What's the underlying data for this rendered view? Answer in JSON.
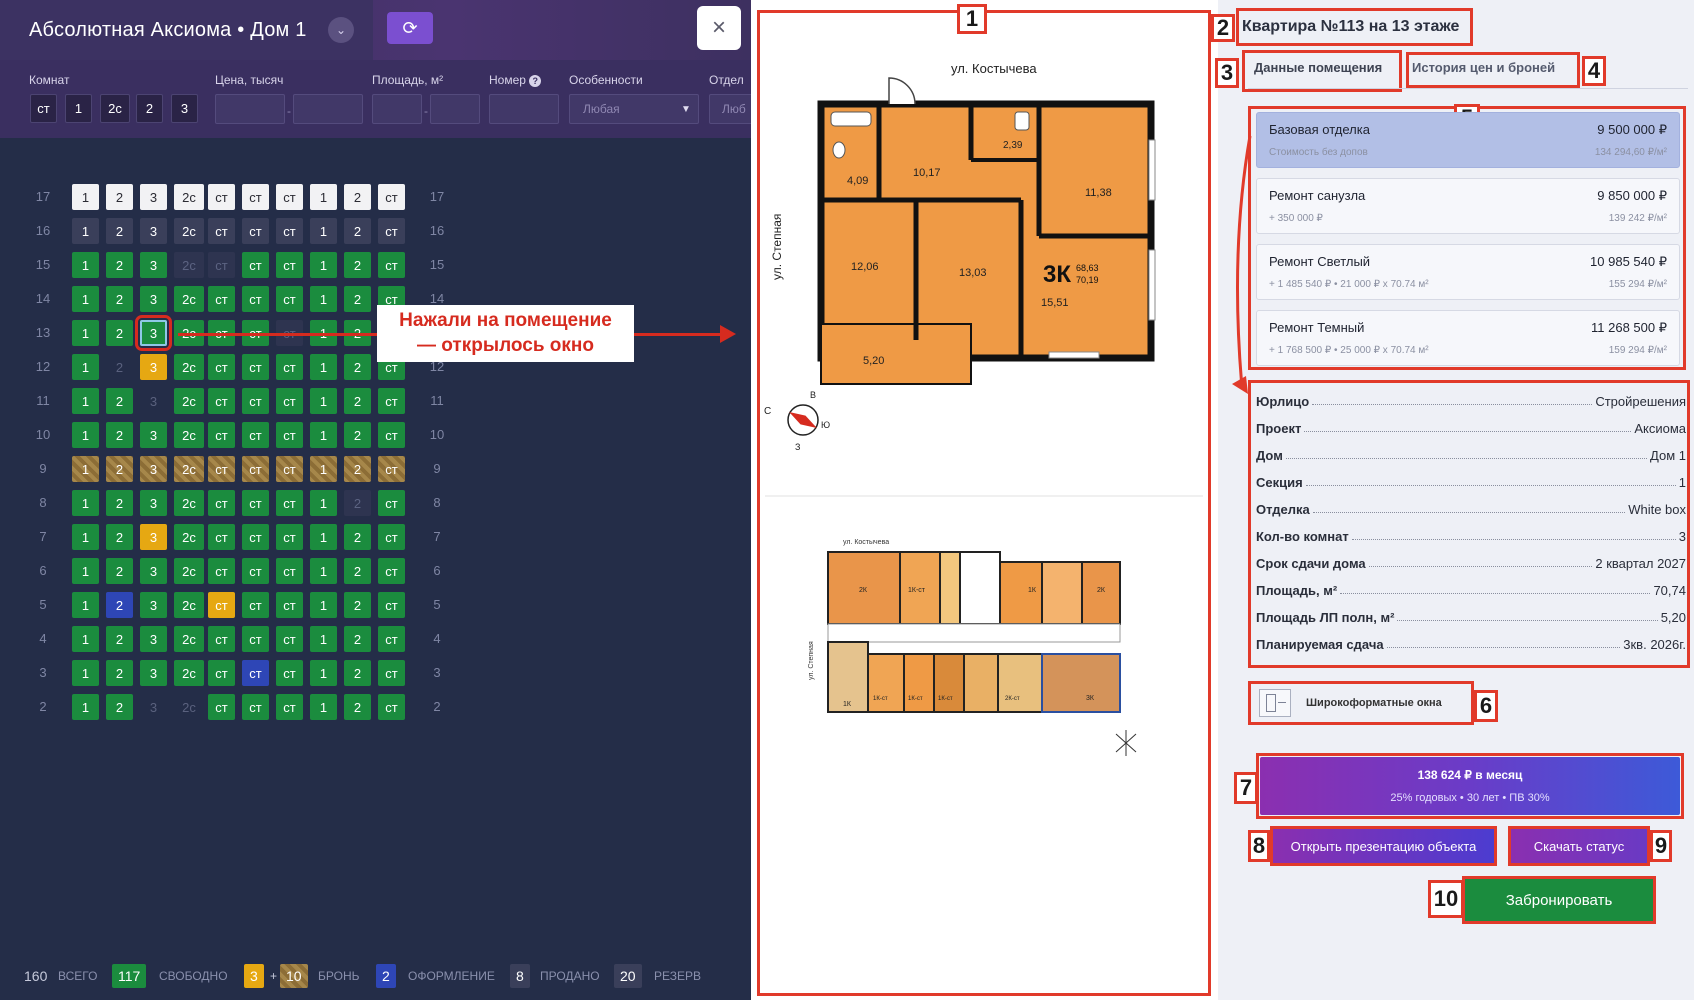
{
  "header": {
    "title": "Абсолютная Аксиома • Дом 1",
    "close": "×",
    "refresh": "⟳",
    "caret": "⌄"
  },
  "filters": {
    "rooms_label": "Комнат",
    "rooms": [
      "ст",
      "1",
      "2с",
      "2",
      "3"
    ],
    "price_label": "Цена, тысяч",
    "area_label": "Площадь, м²",
    "number_label": "Номер",
    "features_label": "Особенности",
    "features_value": "Любая",
    "finish_label": "Отдел",
    "finish_value": "Люб"
  },
  "grid": {
    "rows": [
      {
        "floor": "17",
        "cells": [
          [
            "1",
            "white"
          ],
          [
            "2",
            "white"
          ],
          [
            "3",
            "white"
          ],
          [
            "2с",
            "white"
          ],
          [
            "ст",
            "white"
          ],
          [
            "ст",
            "white"
          ],
          [
            "ст",
            "white"
          ],
          [
            "1",
            "white"
          ],
          [
            "2",
            "white"
          ],
          [
            "ст",
            "white"
          ]
        ]
      },
      {
        "floor": "16",
        "cells": [
          [
            "1",
            "gray"
          ],
          [
            "2",
            "gray"
          ],
          [
            "3",
            "gray"
          ],
          [
            "2с",
            "gray"
          ],
          [
            "ст",
            "gray"
          ],
          [
            "ст",
            "gray"
          ],
          [
            "ст",
            "gray"
          ],
          [
            "1",
            "gray"
          ],
          [
            "2",
            "gray"
          ],
          [
            "ст",
            "gray"
          ]
        ]
      },
      {
        "floor": "15",
        "cells": [
          [
            "1",
            "green"
          ],
          [
            "2",
            "green"
          ],
          [
            "3",
            "green"
          ],
          [
            "2с",
            "dim"
          ],
          [
            "ст",
            "dim"
          ],
          [
            "ст",
            "green"
          ],
          [
            "ст",
            "green"
          ],
          [
            "1",
            "green"
          ],
          [
            "2",
            "green"
          ],
          [
            "ст",
            "green"
          ]
        ]
      },
      {
        "floor": "14",
        "cells": [
          [
            "1",
            "green"
          ],
          [
            "2",
            "green"
          ],
          [
            "3",
            "green"
          ],
          [
            "2с",
            "green"
          ],
          [
            "ст",
            "green"
          ],
          [
            "ст",
            "green"
          ],
          [
            "ст",
            "green"
          ],
          [
            "1",
            "green"
          ],
          [
            "2",
            "green"
          ],
          [
            "ст",
            "green"
          ]
        ]
      },
      {
        "floor": "13",
        "cells": [
          [
            "1",
            "green"
          ],
          [
            "2",
            "green"
          ],
          [
            "3",
            "selected"
          ],
          [
            "2с",
            "green"
          ],
          [
            "ст",
            "green"
          ],
          [
            "ст",
            "green"
          ],
          [
            "ст",
            "dim"
          ],
          [
            "1",
            "green"
          ],
          [
            "2",
            "green"
          ],
          [
            "ст",
            "green"
          ]
        ]
      },
      {
        "floor": "12",
        "cells": [
          [
            "1",
            "green"
          ],
          [
            "2",
            "empty"
          ],
          [
            "3",
            "yellow"
          ],
          [
            "2с",
            "green"
          ],
          [
            "ст",
            "green"
          ],
          [
            "ст",
            "green"
          ],
          [
            "ст",
            "green"
          ],
          [
            "1",
            "green"
          ],
          [
            "2",
            "green"
          ],
          [
            "ст",
            "green"
          ]
        ]
      },
      {
        "floor": "11",
        "cells": [
          [
            "1",
            "green"
          ],
          [
            "2",
            "green"
          ],
          [
            "3",
            "empty"
          ],
          [
            "2с",
            "green"
          ],
          [
            "ст",
            "green"
          ],
          [
            "ст",
            "green"
          ],
          [
            "ст",
            "green"
          ],
          [
            "1",
            "green"
          ],
          [
            "2",
            "green"
          ],
          [
            "ст",
            "green"
          ]
        ]
      },
      {
        "floor": "10",
        "cells": [
          [
            "1",
            "green"
          ],
          [
            "2",
            "green"
          ],
          [
            "3",
            "green"
          ],
          [
            "2с",
            "green"
          ],
          [
            "ст",
            "green"
          ],
          [
            "ст",
            "green"
          ],
          [
            "ст",
            "green"
          ],
          [
            "1",
            "green"
          ],
          [
            "2",
            "green"
          ],
          [
            "ст",
            "green"
          ]
        ]
      },
      {
        "floor": "9",
        "cells": [
          [
            "1",
            "stripe"
          ],
          [
            "2",
            "stripe"
          ],
          [
            "3",
            "stripe"
          ],
          [
            "2с",
            "stripe"
          ],
          [
            "ст",
            "stripe"
          ],
          [
            "ст",
            "stripe"
          ],
          [
            "ст",
            "stripe"
          ],
          [
            "1",
            "stripe"
          ],
          [
            "2",
            "stripe"
          ],
          [
            "ст",
            "stripe"
          ]
        ]
      },
      {
        "floor": "8",
        "cells": [
          [
            "1",
            "green"
          ],
          [
            "2",
            "green"
          ],
          [
            "3",
            "green"
          ],
          [
            "2с",
            "green"
          ],
          [
            "ст",
            "green"
          ],
          [
            "ст",
            "green"
          ],
          [
            "ст",
            "green"
          ],
          [
            "1",
            "green"
          ],
          [
            "2",
            "dim"
          ],
          [
            "ст",
            "green"
          ]
        ]
      },
      {
        "floor": "7",
        "cells": [
          [
            "1",
            "green"
          ],
          [
            "2",
            "green"
          ],
          [
            "3",
            "yellow"
          ],
          [
            "2с",
            "green"
          ],
          [
            "ст",
            "green"
          ],
          [
            "ст",
            "green"
          ],
          [
            "ст",
            "green"
          ],
          [
            "1",
            "green"
          ],
          [
            "2",
            "green"
          ],
          [
            "ст",
            "green"
          ]
        ]
      },
      {
        "floor": "6",
        "cells": [
          [
            "1",
            "green"
          ],
          [
            "2",
            "green"
          ],
          [
            "3",
            "green"
          ],
          [
            "2с",
            "green"
          ],
          [
            "ст",
            "green"
          ],
          [
            "ст",
            "green"
          ],
          [
            "ст",
            "green"
          ],
          [
            "1",
            "green"
          ],
          [
            "2",
            "green"
          ],
          [
            "ст",
            "green"
          ]
        ]
      },
      {
        "floor": "5",
        "cells": [
          [
            "1",
            "green"
          ],
          [
            "2",
            "blue"
          ],
          [
            "3",
            "green"
          ],
          [
            "2с",
            "green"
          ],
          [
            "ст",
            "yellow"
          ],
          [
            "ст",
            "green"
          ],
          [
            "ст",
            "green"
          ],
          [
            "1",
            "green"
          ],
          [
            "2",
            "green"
          ],
          [
            "ст",
            "green"
          ]
        ]
      },
      {
        "floor": "4",
        "cells": [
          [
            "1",
            "green"
          ],
          [
            "2",
            "green"
          ],
          [
            "3",
            "green"
          ],
          [
            "2с",
            "green"
          ],
          [
            "ст",
            "green"
          ],
          [
            "ст",
            "green"
          ],
          [
            "ст",
            "green"
          ],
          [
            "1",
            "green"
          ],
          [
            "2",
            "green"
          ],
          [
            "ст",
            "green"
          ]
        ]
      },
      {
        "floor": "3",
        "cells": [
          [
            "1",
            "green"
          ],
          [
            "2",
            "green"
          ],
          [
            "3",
            "green"
          ],
          [
            "2с",
            "green"
          ],
          [
            "ст",
            "green"
          ],
          [
            "ст",
            "blue"
          ],
          [
            "ст",
            "green"
          ],
          [
            "1",
            "green"
          ],
          [
            "2",
            "green"
          ],
          [
            "ст",
            "green"
          ]
        ]
      },
      {
        "floor": "2",
        "cells": [
          [
            "1",
            "green"
          ],
          [
            "2",
            "green"
          ],
          [
            "3",
            "empty"
          ],
          [
            "2с",
            "empty"
          ],
          [
            "ст",
            "green"
          ],
          [
            "ст",
            "green"
          ],
          [
            "ст",
            "green"
          ],
          [
            "1",
            "green"
          ],
          [
            "2",
            "green"
          ],
          [
            "ст",
            "green"
          ]
        ]
      }
    ]
  },
  "callout": {
    "line1": "Нажали на помещение",
    "line2": "— открылось окно"
  },
  "legend": {
    "total_num": "160",
    "total_label": "всего",
    "free_num": "117",
    "free_label": "свободно",
    "booked_a": "3",
    "plus": "+",
    "booked_b": "10",
    "booked_label": "бронь",
    "processing_num": "2",
    "processing_label": "оформление",
    "sold_num": "8",
    "sold_label": "продано",
    "reserve_num": "20",
    "reserve_label": "резерв"
  },
  "floorplan": {
    "street_top": "ул. Костычева",
    "street_left": "ул. Степная",
    "rooms": [
      "4,09",
      "10,17",
      "2,39",
      "11,38",
      "12,06",
      "13,03",
      "15,51",
      "5,20"
    ],
    "apt_type": "3К",
    "area_a": "68,63",
    "area_b": "70,19",
    "compass": [
      "С",
      "В",
      "Ю",
      "З"
    ],
    "small_street_top": "ул. Костычева",
    "small_street_left": "ул. Степная",
    "unit_labels": [
      "2К",
      "1К-ст",
      "1К",
      "2К",
      "1К",
      "1К-ст",
      "1К-ст",
      "1К-ст",
      "2К-ст",
      "3К"
    ]
  },
  "tags": [
    "1",
    "2",
    "3",
    "4",
    "5",
    "6",
    "7",
    "8",
    "9",
    "10"
  ],
  "apartment": {
    "title": "Квартира №113 на 13 этаже",
    "tab_data": "Данные помещения",
    "tab_history": "История цен и броней"
  },
  "prices": [
    {
      "name": "Базовая отделка",
      "value": "9 500 000 ₽",
      "sub": "Стоимость без допов",
      "per_m": "134 294,60 ₽/м²"
    },
    {
      "name": "Ремонт санузла",
      "value": "9 850 000 ₽",
      "sub": "+ 350 000 ₽",
      "per_m": "139 242 ₽/м²"
    },
    {
      "name": "Ремонт Светлый",
      "value": "10 985 540 ₽",
      "sub": "+ 1 485 540 ₽ • 21 000 ₽ x 70.74 м²",
      "per_m": "155 294 ₽/м²"
    },
    {
      "name": "Ремонт Темный",
      "value": "11 268 500 ₽",
      "sub": "+ 1 768 500 ₽ • 25 000 ₽ x 70.74 м²",
      "per_m": "159 294 ₽/м²"
    }
  ],
  "properties": [
    {
      "k": "Юрлицо",
      "v": "Стройрешения"
    },
    {
      "k": "Проект",
      "v": "Аксиома"
    },
    {
      "k": "Дом",
      "v": "Дом 1"
    },
    {
      "k": "Секция",
      "v": "1"
    },
    {
      "k": "Отделка",
      "v": "White box"
    },
    {
      "k": "Кол-во комнат",
      "v": "3"
    },
    {
      "k": "Срок сдачи дома",
      "v": "2 квартал 2027"
    },
    {
      "k": "Площадь, м²",
      "v": "70,74"
    },
    {
      "k": "Площадь ЛП полн, м²",
      "v": "5,20"
    },
    {
      "k": "Планируемая сдача",
      "v": "3кв. 2026г."
    }
  ],
  "feature": {
    "label": "Широкоформатные окна"
  },
  "mortgage": {
    "main": "138 624 ₽ в месяц",
    "sub": "25% годовых • 30 лет • ПВ 30%"
  },
  "buttons": {
    "presentation": "Открыть презентацию объекта",
    "status": "Скачать статус",
    "book": "Забронировать"
  }
}
